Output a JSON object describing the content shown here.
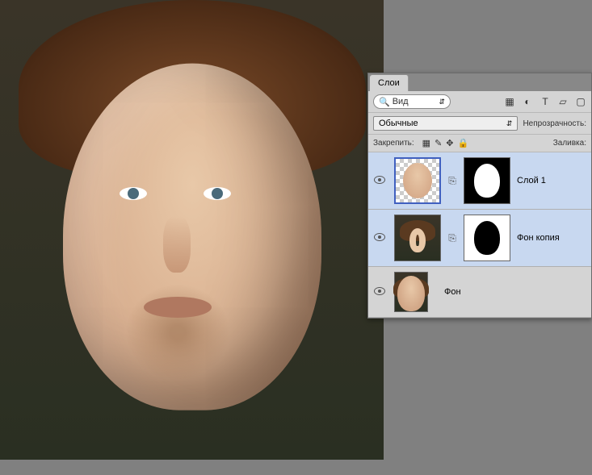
{
  "panel": {
    "tab_layers": "Слои",
    "search": {
      "placeholder": "Вид"
    },
    "filter_icons": [
      "image-icon",
      "adjust-icon",
      "type-icon",
      "shape-icon",
      "smart-icon"
    ],
    "blend_mode": "Обычные",
    "opacity_label": "Непрозрачность:",
    "lock_label": "Закрепить:",
    "fill_label": "Заливка:"
  },
  "layers": [
    {
      "name": "Слой 1",
      "visible": true,
      "selected": true,
      "has_mask": true,
      "mask_style": "black"
    },
    {
      "name": "Фон копия",
      "visible": true,
      "selected": true,
      "has_mask": true,
      "mask_style": "white"
    },
    {
      "name": "Фон",
      "visible": true,
      "selected": false,
      "has_mask": false
    }
  ]
}
